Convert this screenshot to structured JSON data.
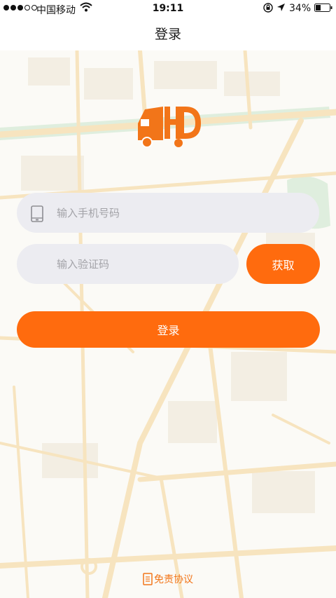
{
  "status_bar": {
    "carrier": "中国移动",
    "time": "19:11",
    "battery": "34%"
  },
  "nav": {
    "title": "登录"
  },
  "form": {
    "phone_placeholder": "输入手机号码",
    "code_placeholder": "输入验证码",
    "get_code_label": "获取",
    "login_label": "登录"
  },
  "footer": {
    "disclaimer_label": "免责协议"
  },
  "colors": {
    "accent": "#ff6b0e",
    "field_bg": "#ececf1",
    "map_road": "#f7e4bf",
    "map_park": "#dfeede"
  },
  "icons": {
    "phone": "phone-icon",
    "logo": "truck-logo",
    "doc": "doc-icon"
  }
}
